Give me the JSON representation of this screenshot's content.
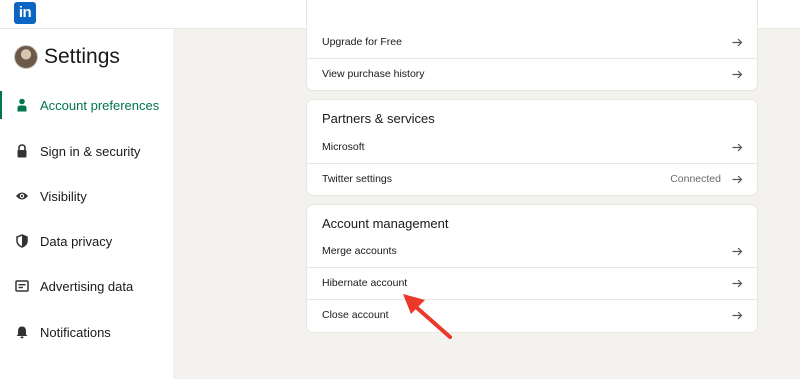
{
  "brand": {
    "logo_text": "in"
  },
  "sidebar": {
    "title": "Settings",
    "items": [
      {
        "label": "Account preferences",
        "icon": "person-icon",
        "active": true
      },
      {
        "label": "Sign in & security",
        "icon": "lock-icon"
      },
      {
        "label": "Visibility",
        "icon": "eye-icon"
      },
      {
        "label": "Data privacy",
        "icon": "shield-icon"
      },
      {
        "label": "Advertising data",
        "icon": "ad-icon"
      },
      {
        "label": "Notifications",
        "icon": "bell-icon"
      }
    ]
  },
  "main": {
    "subscription_rows": [
      {
        "label": "Upgrade for Free"
      },
      {
        "label": "View purchase history"
      }
    ],
    "partners": {
      "title": "Partners & services",
      "rows": [
        {
          "label": "Microsoft",
          "status": ""
        },
        {
          "label": "Twitter settings",
          "status": "Connected"
        }
      ]
    },
    "account_management": {
      "title": "Account management",
      "rows": [
        {
          "label": "Merge accounts"
        },
        {
          "label": "Hibernate account"
        },
        {
          "label": "Close account"
        }
      ]
    }
  },
  "colors": {
    "accent": "#01754f",
    "brand": "#0a66c2",
    "annotation": "#e8392b",
    "page_bg": "#f4f2ee"
  }
}
